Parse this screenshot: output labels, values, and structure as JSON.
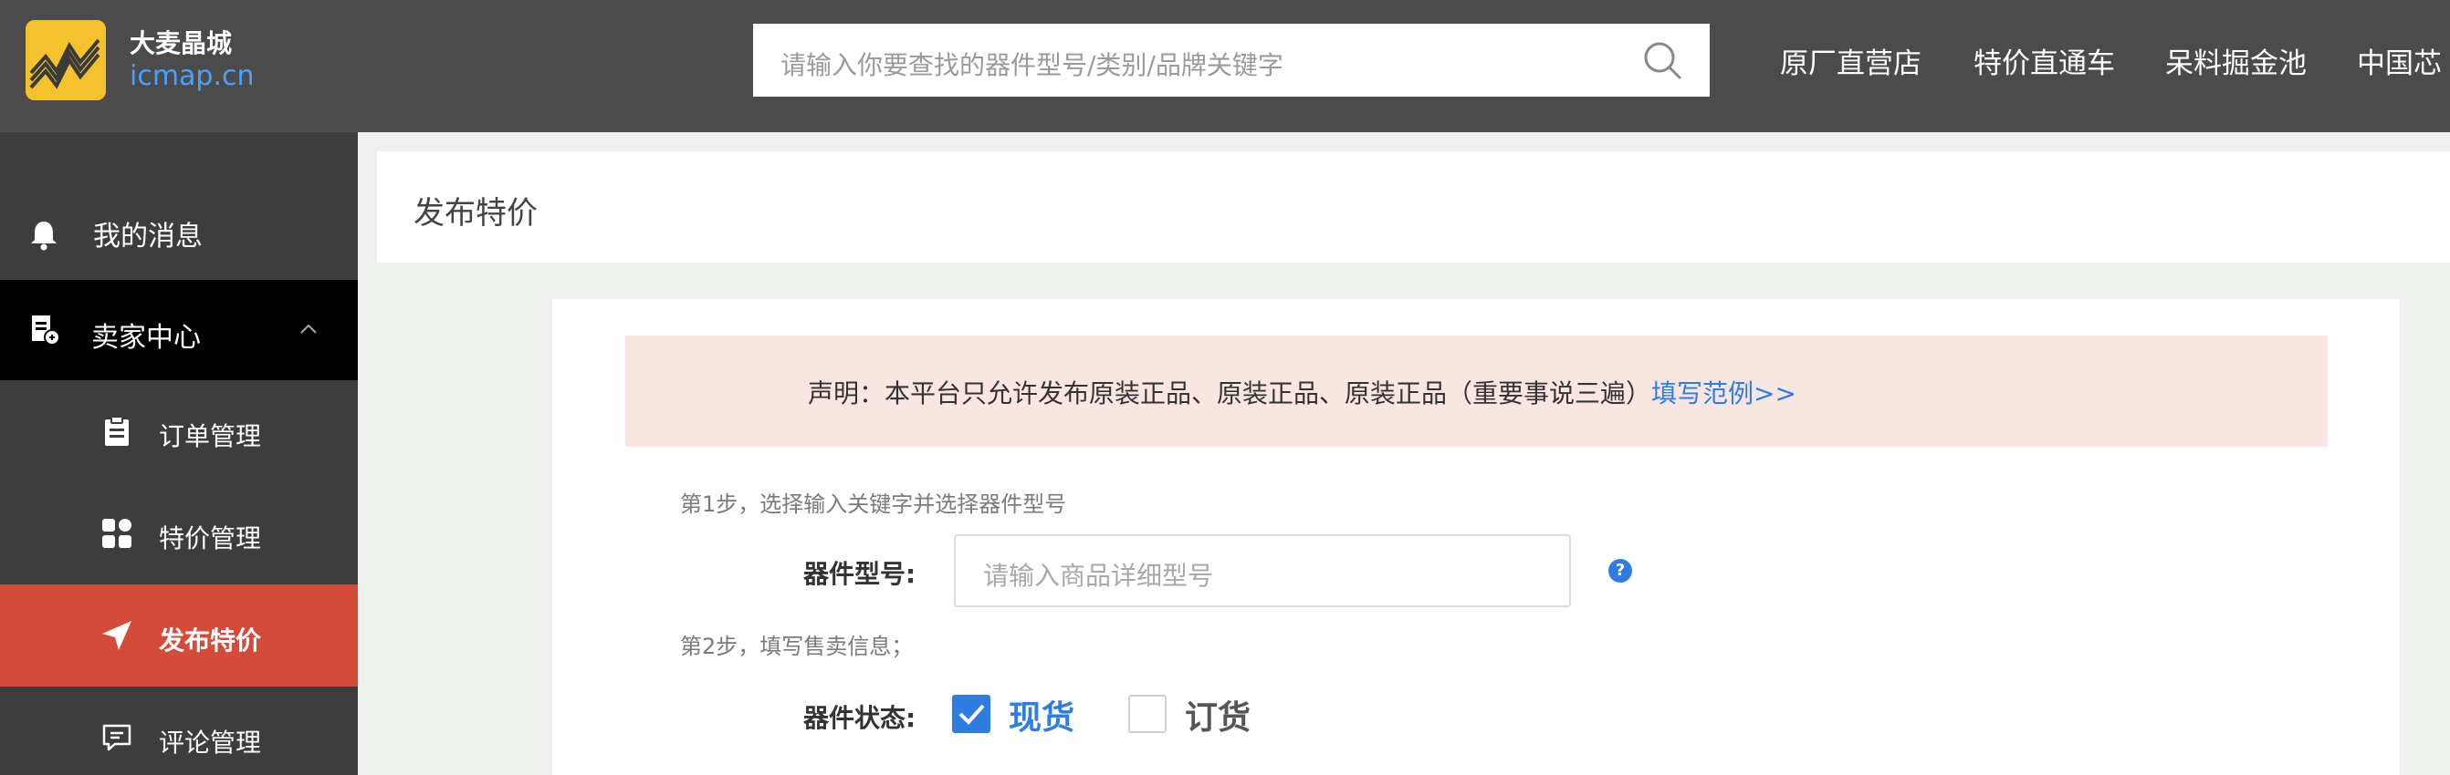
{
  "header": {
    "brand_name": "大麦晶城",
    "brand_url": "icmap.cn",
    "search_placeholder": "请输入你要查找的器件型号/类别/品牌关键字",
    "nav": [
      "原厂直营店",
      "特价直通车",
      "呆料掘金池",
      "中国芯"
    ]
  },
  "sidebar": {
    "items": [
      {
        "label": "我的消息",
        "icon": "bell-icon"
      },
      {
        "label": "卖家中心",
        "icon": "seller-doc-icon"
      },
      {
        "label": "订单管理",
        "icon": "clipboard-icon"
      },
      {
        "label": "特价管理",
        "icon": "grid-icon"
      },
      {
        "label": "发布特价",
        "icon": "paper-plane-icon"
      },
      {
        "label": "评论管理",
        "icon": "comment-icon"
      }
    ]
  },
  "page": {
    "title": "发布特价",
    "notice": "声明：本平台只允许发布原装正品、原装正品、原装正品（重要事说三遍）",
    "notice_link": "填写范例>>",
    "step1": "第1步，选择输入关键字并选择器件型号",
    "part_label": "器件型号:",
    "part_placeholder": "请输入商品详细型号",
    "help": "?",
    "step2": "第2步，填写售卖信息；",
    "status_label": "器件状态:",
    "status_options": [
      {
        "label": "现货",
        "checked": true
      },
      {
        "label": "订货",
        "checked": false
      }
    ]
  },
  "colors": {
    "topbar": "#4b4b4b",
    "sidebar": "#3d3d3d",
    "sidebar_group_active": "#000000",
    "sidebar_item_active": "#d44b3a",
    "accent_blue": "#2f7de1",
    "notice_bg": "#f9e6e3",
    "logo_yellow": "#f3c22c"
  }
}
